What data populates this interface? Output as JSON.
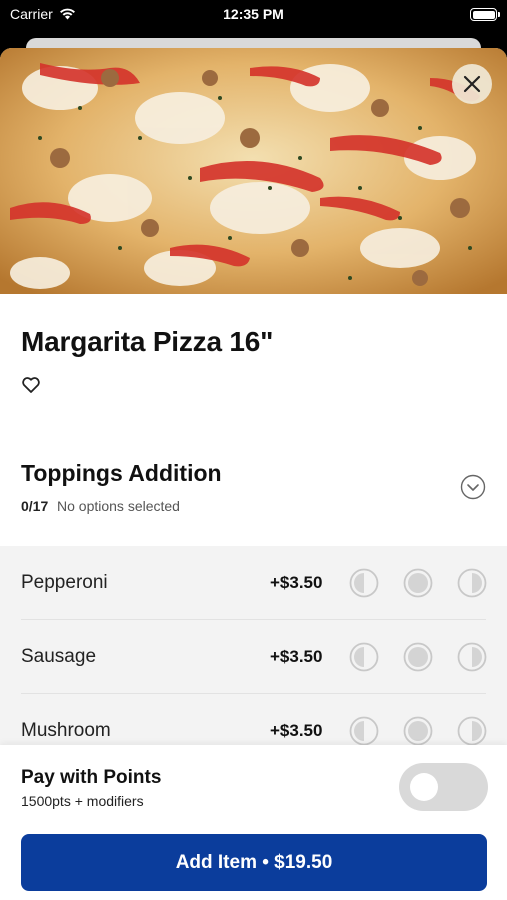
{
  "status_bar": {
    "carrier": "Carrier",
    "time": "12:35 PM",
    "icons": [
      "wifi-icon",
      "battery-icon"
    ]
  },
  "item": {
    "title": "Margarita Pizza 16\"",
    "image": "pizza-photo",
    "favorite_icon": "heart-icon",
    "close_icon": "close-icon"
  },
  "modifier_group": {
    "title": "Toppings Addition",
    "count": "0/17",
    "status": "No options selected",
    "expand_icon": "chevron-down-circle-icon",
    "options": [
      {
        "name": "Pepperoni",
        "price": "+$3.50",
        "placements": [
          "left-half-icon",
          "whole-icon",
          "right-half-icon"
        ]
      },
      {
        "name": "Sausage",
        "price": "+$3.50",
        "placements": [
          "left-half-icon",
          "whole-icon",
          "right-half-icon"
        ]
      },
      {
        "name": "Mushroom",
        "price": "+$3.50",
        "placements": [
          "left-half-icon",
          "whole-icon",
          "right-half-icon"
        ]
      }
    ]
  },
  "points": {
    "title": "Pay with Points",
    "subtitle": "1500pts + modifiers",
    "enabled": false
  },
  "add_button": {
    "label": "Add Item • $19.50"
  },
  "colors": {
    "primary": "#0b3d9c",
    "options_bg": "#f3f3f3",
    "toggle_off": "#d9d9d9"
  }
}
